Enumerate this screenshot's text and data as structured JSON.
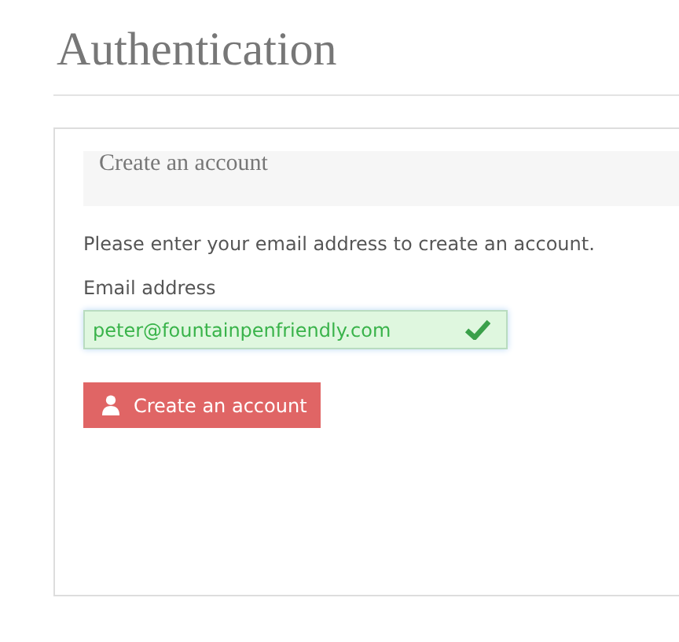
{
  "page_title": "Authentication",
  "panel": {
    "heading": "Create an account",
    "instructions": "Please enter your email address to create an account.",
    "email_field": {
      "label": "Email address",
      "value": "peter@fountainpenfriendly.com",
      "valid": true
    },
    "submit_button": {
      "label": "Create an account"
    }
  }
}
